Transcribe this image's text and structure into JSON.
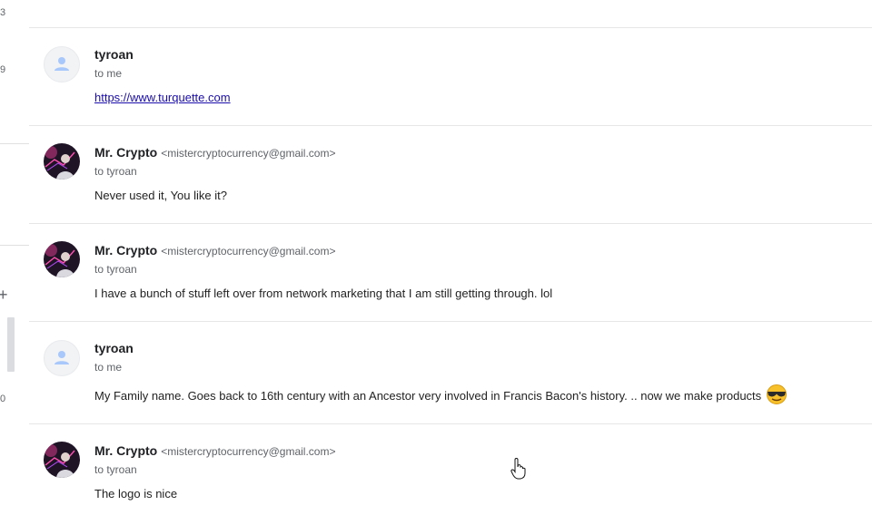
{
  "left_rail": {
    "fragments": [
      "3",
      "9",
      "+",
      "0"
    ]
  },
  "messages": [
    {
      "sender_name": "tyroan",
      "sender_email": "",
      "recipient": "to me",
      "body": "https://www.turquette.com",
      "is_link": true,
      "avatar": "default-person"
    },
    {
      "sender_name": "Mr. Crypto",
      "sender_email": "<mistercryptocurrency@gmail.com>",
      "recipient": "to tyroan",
      "body": "Never used it, You like it?",
      "avatar": "photo"
    },
    {
      "sender_name": "Mr. Crypto",
      "sender_email": "<mistercryptocurrency@gmail.com>",
      "recipient": "to tyroan",
      "body": "I have a bunch of stuff left over from network marketing that I am still getting through. lol",
      "avatar": "photo"
    },
    {
      "sender_name": "tyroan",
      "sender_email": "",
      "recipient": "to me",
      "body": "My Family name. Goes back to 16th century with an Ancestor very involved in Francis Bacon's history. .. now we make products",
      "emoji": "sunglasses-emoji",
      "avatar": "default-person"
    },
    {
      "sender_name": "Mr. Crypto",
      "sender_email": "<mistercryptocurrency@gmail.com>",
      "recipient": "to tyroan",
      "body": "The logo is nice",
      "avatar": "photo"
    }
  ],
  "colors": {
    "link": "#1a0dab",
    "divider": "#e6e6e6",
    "secondary_text": "#5f6368"
  }
}
